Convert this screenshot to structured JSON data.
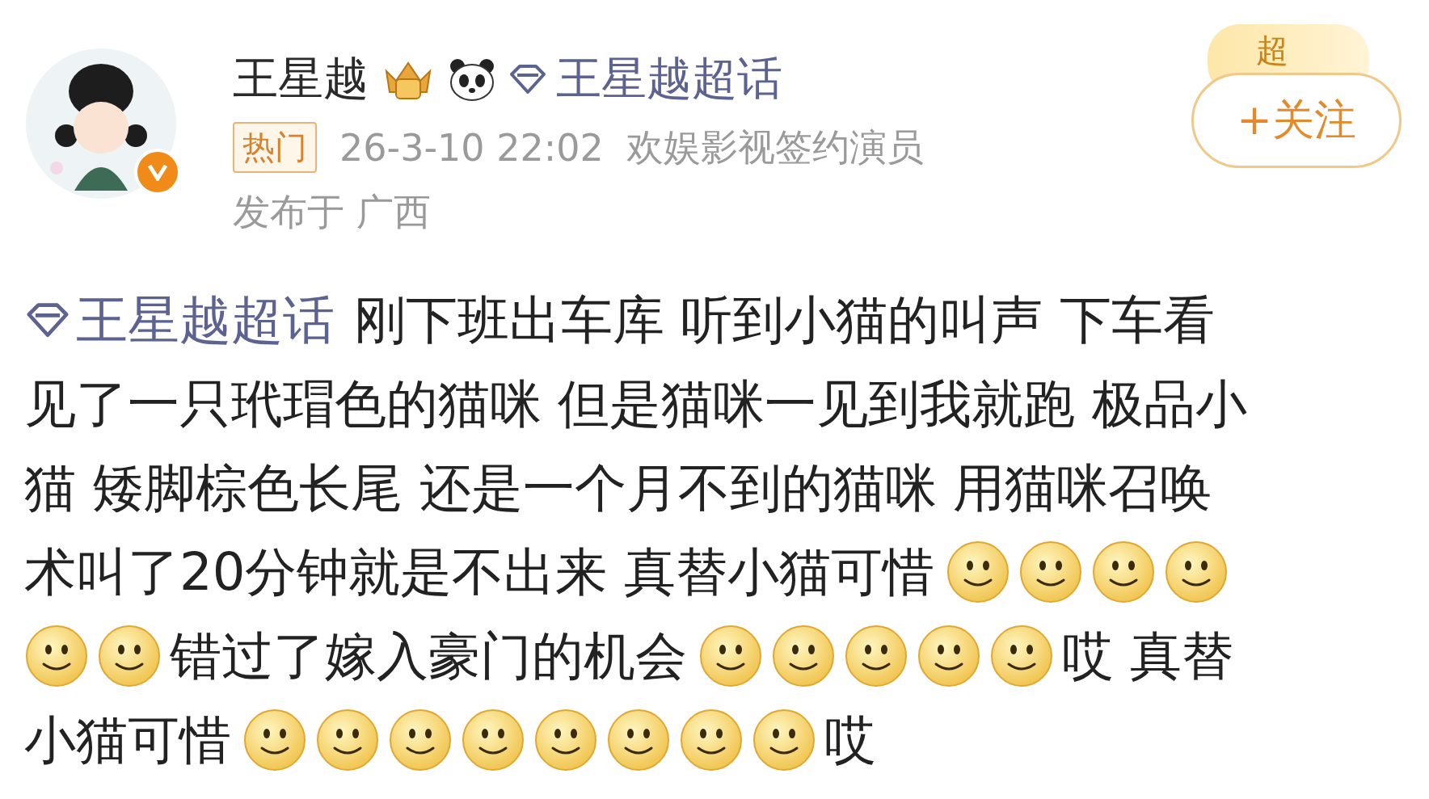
{
  "author": {
    "name": "王星越",
    "verified": true
  },
  "topic_link": "王星越超话",
  "follow_button": "+关注",
  "sticker": "超",
  "meta": {
    "tag": "热门",
    "time": "26-3-10 22:02",
    "description": "欢娱影视签约演员",
    "location": "发布于 广西"
  },
  "body": [
    [
      {
        "kind": "topic",
        "text": "王星越超话"
      },
      {
        "kind": "text",
        "text": "刚下班出车库 听到小猫的叫声 下车看"
      }
    ],
    [
      {
        "kind": "text",
        "text": "见了一只玳瑁色的猫咪 但是猫咪一见到我就跑 极品小"
      }
    ],
    [
      {
        "kind": "text",
        "text": "猫 矮脚棕色长尾 还是一个月不到的猫咪 用猫咪召唤"
      }
    ],
    [
      {
        "kind": "text",
        "text": "术叫了20分钟就是不出来 真替小猫可惜"
      },
      {
        "kind": "emoji"
      },
      {
        "kind": "emoji"
      },
      {
        "kind": "emoji"
      },
      {
        "kind": "emoji"
      }
    ],
    [
      {
        "kind": "emoji"
      },
      {
        "kind": "emoji"
      },
      {
        "kind": "text",
        "text": "错过了嫁入豪门的机会"
      },
      {
        "kind": "emoji"
      },
      {
        "kind": "emoji"
      },
      {
        "kind": "emoji"
      },
      {
        "kind": "emoji"
      },
      {
        "kind": "emoji"
      },
      {
        "kind": "text",
        "text": "哎 真替"
      }
    ],
    [
      {
        "kind": "text",
        "text": "小猫可惜"
      },
      {
        "kind": "emoji"
      },
      {
        "kind": "emoji"
      },
      {
        "kind": "emoji"
      },
      {
        "kind": "emoji"
      },
      {
        "kind": "emoji"
      },
      {
        "kind": "emoji"
      },
      {
        "kind": "emoji"
      },
      {
        "kind": "emoji"
      },
      {
        "kind": "text",
        "text": "哎"
      }
    ]
  ]
}
